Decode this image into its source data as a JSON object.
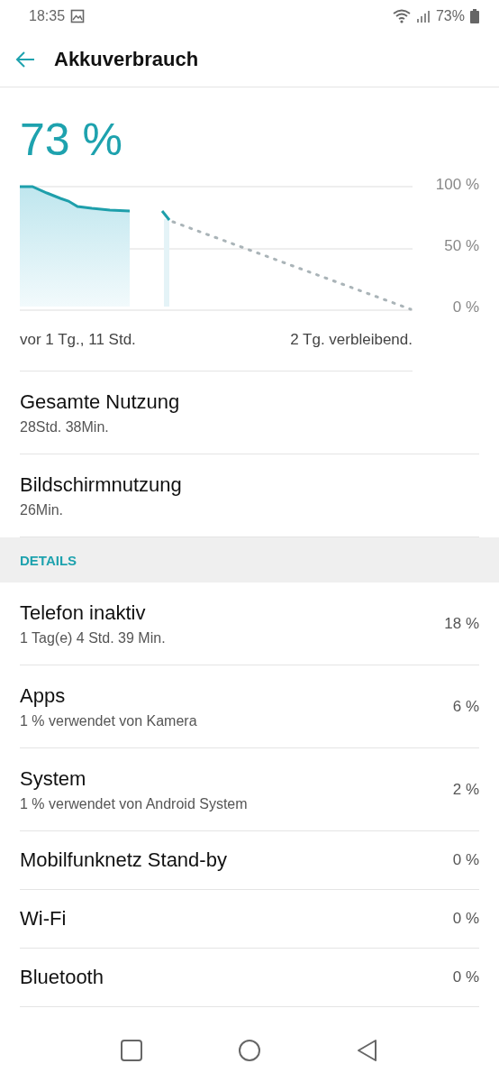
{
  "status_bar": {
    "time": "18:35",
    "battery": "73%"
  },
  "header": {
    "title": "Akkuverbrauch"
  },
  "battery_level": "73 %",
  "chart": {
    "y_labels": [
      "100 %",
      "50 %",
      "0 %"
    ],
    "x_start": "vor 1 Tg., 11 Std.",
    "x_end": "2 Tg. verbleibend."
  },
  "usage": [
    {
      "title": "Gesamte Nutzung",
      "subtitle": "28Std. 38Min."
    },
    {
      "title": "Bildschirmnutzung",
      "subtitle": "26Min."
    }
  ],
  "section_header": "DETAILS",
  "details": [
    {
      "title": "Telefon inaktiv",
      "subtitle": "1 Tag(e) 4 Std. 39 Min.",
      "percent": "18 %"
    },
    {
      "title": "Apps",
      "subtitle": "1 % verwendet von Kamera",
      "percent": "6 %"
    },
    {
      "title": "System",
      "subtitle": "1 % verwendet von Android System",
      "percent": "2 %"
    },
    {
      "title": "Mobilfunknetz Stand-by",
      "percent": "0 %"
    },
    {
      "title": "Wi-Fi",
      "percent": "0 %"
    },
    {
      "title": "Bluetooth",
      "percent": "0 %"
    }
  ]
}
